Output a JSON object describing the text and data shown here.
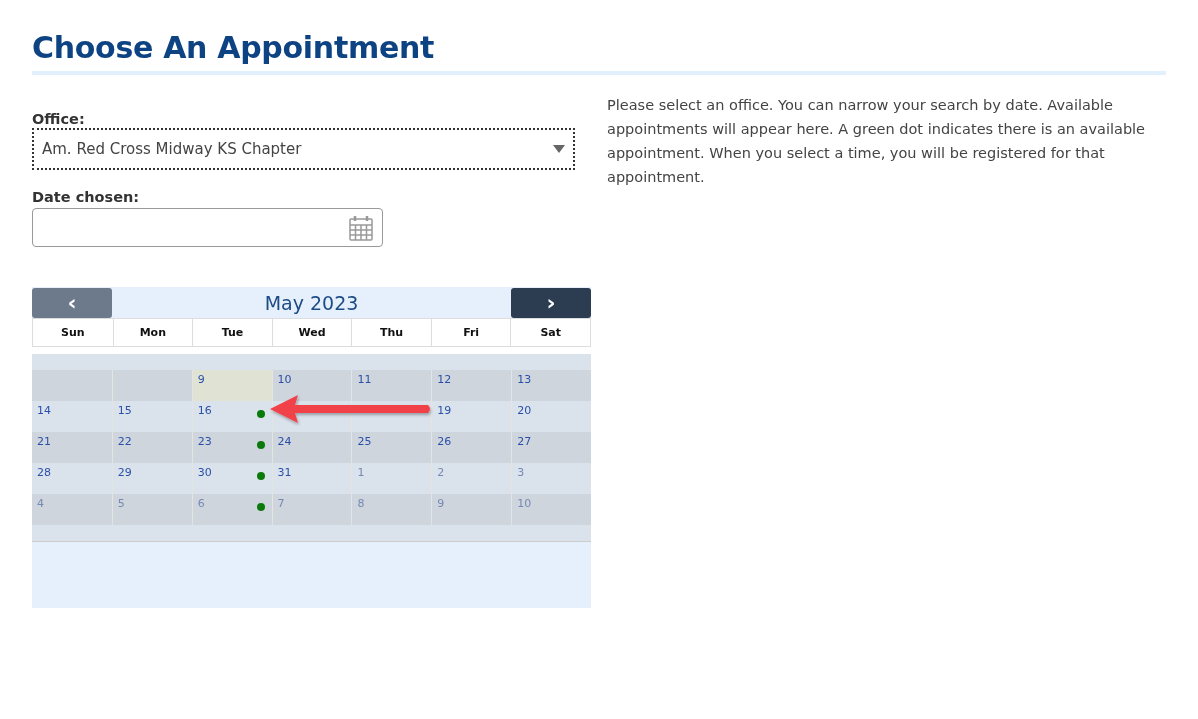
{
  "title": "Choose An Appointment",
  "office": {
    "label": "Office:",
    "value": "Am. Red Cross Midway KS Chapter"
  },
  "date": {
    "label": "Date chosen:"
  },
  "help_text": "Please select an office. You can narrow your search by date. Available appointments will appear here. A green dot indicates there is an available appointment. When you select a time, you will be registered for that appointment.",
  "calendar": {
    "month": "May 2023",
    "prev": "‹",
    "next": "›",
    "weekdays": [
      "Sun",
      "Mon",
      "Tue",
      "Wed",
      "Thu",
      "Fri",
      "Sat"
    ],
    "weeks": [
      [
        {
          "kind": "empty"
        },
        {
          "kind": "empty"
        },
        {
          "kind": "empty"
        },
        {
          "kind": "empty"
        },
        {
          "kind": "empty"
        },
        {
          "kind": "empty"
        },
        {
          "kind": "empty"
        }
      ],
      [
        {
          "kind": "empty"
        },
        {
          "kind": "empty"
        },
        {
          "kind": "day",
          "day": "9",
          "today": true,
          "available": false,
          "other_month": false
        },
        {
          "kind": "day",
          "day": "10",
          "today": false,
          "available": false,
          "other_month": false
        },
        {
          "kind": "day",
          "day": "11",
          "today": false,
          "available": false,
          "other_month": false
        },
        {
          "kind": "day",
          "day": "12",
          "today": false,
          "available": false,
          "other_month": false
        },
        {
          "kind": "day",
          "day": "13",
          "today": false,
          "available": false,
          "other_month": false
        }
      ],
      [
        {
          "kind": "day",
          "day": "14",
          "today": false,
          "available": false,
          "other_month": false
        },
        {
          "kind": "day",
          "day": "15",
          "today": false,
          "available": false,
          "other_month": false
        },
        {
          "kind": "day",
          "day": "16",
          "today": false,
          "available": true,
          "other_month": false
        },
        {
          "kind": "empty"
        },
        {
          "kind": "empty"
        },
        {
          "kind": "day",
          "day": "19",
          "today": false,
          "available": false,
          "other_month": false
        },
        {
          "kind": "day",
          "day": "20",
          "today": false,
          "available": false,
          "other_month": false
        }
      ],
      [
        {
          "kind": "day",
          "day": "21",
          "today": false,
          "available": false,
          "other_month": false
        },
        {
          "kind": "day",
          "day": "22",
          "today": false,
          "available": false,
          "other_month": false
        },
        {
          "kind": "day",
          "day": "23",
          "today": false,
          "available": true,
          "other_month": false
        },
        {
          "kind": "day",
          "day": "24",
          "today": false,
          "available": false,
          "other_month": false
        },
        {
          "kind": "day",
          "day": "25",
          "today": false,
          "available": false,
          "other_month": false
        },
        {
          "kind": "day",
          "day": "26",
          "today": false,
          "available": false,
          "other_month": false
        },
        {
          "kind": "day",
          "day": "27",
          "today": false,
          "available": false,
          "other_month": false
        }
      ],
      [
        {
          "kind": "day",
          "day": "28",
          "today": false,
          "available": false,
          "other_month": false
        },
        {
          "kind": "day",
          "day": "29",
          "today": false,
          "available": false,
          "other_month": false
        },
        {
          "kind": "day",
          "day": "30",
          "today": false,
          "available": true,
          "other_month": false
        },
        {
          "kind": "day",
          "day": "31",
          "today": false,
          "available": false,
          "other_month": false
        },
        {
          "kind": "day",
          "day": "1",
          "today": false,
          "available": false,
          "other_month": true
        },
        {
          "kind": "day",
          "day": "2",
          "today": false,
          "available": false,
          "other_month": true
        },
        {
          "kind": "day",
          "day": "3",
          "today": false,
          "available": false,
          "other_month": true
        }
      ],
      [
        {
          "kind": "day",
          "day": "4",
          "today": false,
          "available": false,
          "other_month": true
        },
        {
          "kind": "day",
          "day": "5",
          "today": false,
          "available": false,
          "other_month": true
        },
        {
          "kind": "day",
          "day": "6",
          "today": false,
          "available": true,
          "other_month": true
        },
        {
          "kind": "day",
          "day": "7",
          "today": false,
          "available": false,
          "other_month": true
        },
        {
          "kind": "day",
          "day": "8",
          "today": false,
          "available": false,
          "other_month": true
        },
        {
          "kind": "day",
          "day": "9",
          "today": false,
          "available": false,
          "other_month": true
        },
        {
          "kind": "day",
          "day": "10",
          "today": false,
          "available": false,
          "other_month": true
        }
      ]
    ]
  }
}
